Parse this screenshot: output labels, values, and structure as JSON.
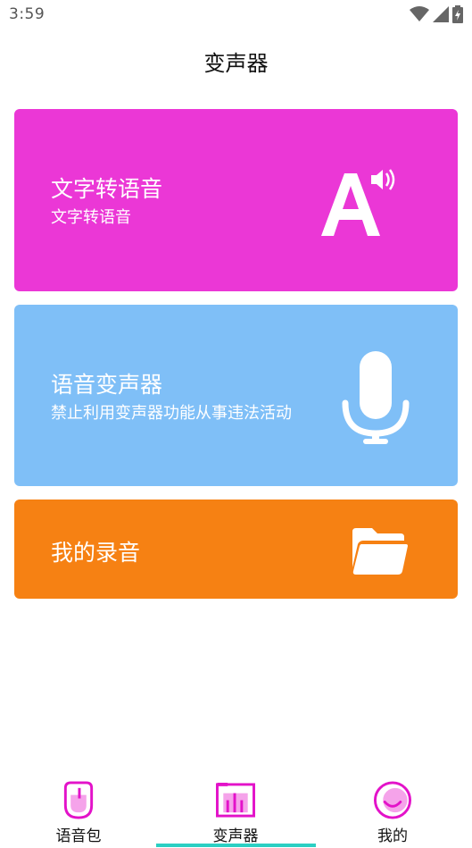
{
  "status": {
    "time": "3:59"
  },
  "header": {
    "title": "变声器"
  },
  "cards": {
    "tts": {
      "title": "文字转语音",
      "subtitle": "文字转语音",
      "icon": "text-to-speech-icon",
      "color": "#eb37d6"
    },
    "voice_changer": {
      "title": "语音变声器",
      "subtitle": "禁止利用变声器功能从事违法活动",
      "icon": "microphone-icon",
      "color": "#7fbff7"
    },
    "recordings": {
      "title": "我的录音",
      "icon": "folder-icon",
      "color": "#f68113"
    }
  },
  "nav": {
    "items": [
      {
        "label": "语音包",
        "icon": "voice-pack-icon"
      },
      {
        "label": "变声器",
        "icon": "voice-changer-icon",
        "active": true
      },
      {
        "label": "我的",
        "icon": "profile-icon"
      }
    ],
    "accent": "#e312c9",
    "indicator_color": "#2bcfc3"
  }
}
